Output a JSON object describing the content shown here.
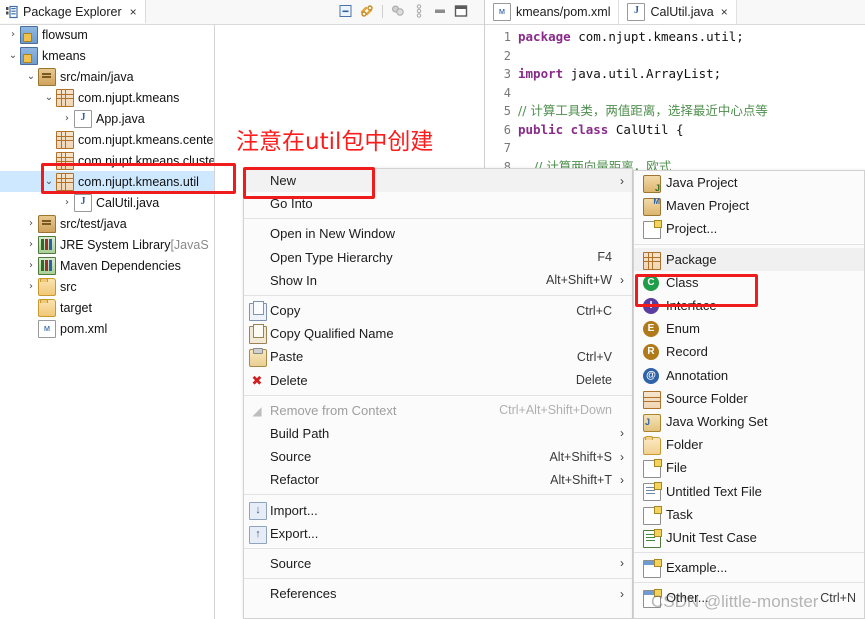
{
  "left_panel": {
    "view_tab": {
      "label": "Package Explorer",
      "close": "×",
      "icon": "package-explorer-icon"
    },
    "toolbar": [
      {
        "name": "collapse-all-icon"
      },
      {
        "name": "link-with-editor-icon"
      },
      {
        "name": "separator"
      },
      {
        "name": "view-menu-bubbles-icon"
      },
      {
        "name": "view-menu-icon"
      },
      {
        "name": "minimize-icon"
      },
      {
        "name": "maximize-icon"
      }
    ],
    "tree": [
      {
        "indent": 0,
        "twist": "›",
        "icon": "ic-proj",
        "label": "flowsum",
        "dim": "",
        "selected": false
      },
      {
        "indent": 0,
        "twist": "⌄",
        "icon": "ic-proj",
        "label": "kmeans",
        "dim": "",
        "selected": false
      },
      {
        "indent": 1,
        "twist": "⌄",
        "icon": "ic-srcfolder",
        "label": "src/main/java",
        "dim": "",
        "selected": false
      },
      {
        "indent": 2,
        "twist": "⌄",
        "icon": "ic-pkg",
        "label": "com.njupt.kmeans",
        "dim": "",
        "selected": false
      },
      {
        "indent": 3,
        "twist": "›",
        "icon": "ic-java",
        "label": "App.java",
        "dim": "",
        "selected": false
      },
      {
        "indent": 2,
        "twist": "",
        "icon": "ic-pkg",
        "label": "com.njupt.kmeans.center",
        "dim": "",
        "selected": false
      },
      {
        "indent": 2,
        "twist": "",
        "icon": "ic-pkg",
        "label": "com.njupt.kmeans.cluster",
        "dim": "",
        "selected": false
      },
      {
        "indent": 2,
        "twist": "⌄",
        "icon": "ic-pkg",
        "label": "com.njupt.kmeans.util",
        "dim": "",
        "selected": true
      },
      {
        "indent": 3,
        "twist": "›",
        "icon": "ic-java",
        "label": "CalUtil.java",
        "dim": "",
        "selected": false
      },
      {
        "indent": 1,
        "twist": "›",
        "icon": "ic-srcfolder",
        "label": "src/test/java",
        "dim": "",
        "selected": false
      },
      {
        "indent": 1,
        "twist": "›",
        "icon": "ic-lib",
        "label": "JRE System Library ",
        "dim": "[JavaS",
        "selected": false
      },
      {
        "indent": 1,
        "twist": "›",
        "icon": "ic-lib",
        "label": "Maven Dependencies",
        "dim": "",
        "selected": false
      },
      {
        "indent": 1,
        "twist": "›",
        "icon": "ic-folder",
        "label": "src",
        "dim": "",
        "selected": false
      },
      {
        "indent": 1,
        "twist": "",
        "icon": "ic-folder",
        "label": "target",
        "dim": "",
        "selected": false
      },
      {
        "indent": 1,
        "twist": "",
        "icon": "ic-xml",
        "label": "pom.xml",
        "dim": "",
        "selected": false
      }
    ]
  },
  "annotation": {
    "red_note": "注意在util包中创建",
    "highlight_color": "#f01c1c"
  },
  "editor": {
    "tabs": [
      {
        "label": "kmeans/pom.xml",
        "icon": "xml-file-icon",
        "active": false,
        "closable": false,
        "close": ""
      },
      {
        "label": "CalUtil.java",
        "icon": "java-file-icon",
        "active": true,
        "closable": true,
        "close": "×"
      }
    ],
    "code_lines": [
      {
        "num": "1",
        "segments": [
          {
            "text": "package ",
            "cls": "kw"
          },
          {
            "text": "com.njupt.kmeans.util;",
            "cls": ""
          }
        ]
      },
      {
        "num": "2",
        "segments": [
          {
            "text": "",
            "cls": ""
          }
        ]
      },
      {
        "num": "3",
        "segments": [
          {
            "text": "import ",
            "cls": "kw"
          },
          {
            "text": "java.util.ArrayList;",
            "cls": ""
          }
        ]
      },
      {
        "num": "4",
        "segments": [
          {
            "text": "",
            "cls": ""
          }
        ]
      },
      {
        "num": "5",
        "segments": [
          {
            "text": "// 计算工具类，两值距离，选择最近中心点等",
            "cls": "cmt cmt-cn"
          }
        ]
      },
      {
        "num": "6",
        "segments": [
          {
            "text": "public class ",
            "cls": "kw"
          },
          {
            "text": "CalUtil {",
            "cls": ""
          }
        ]
      },
      {
        "num": "7",
        "segments": [
          {
            "text": "",
            "cls": ""
          }
        ]
      },
      {
        "num": "8",
        "segments": [
          {
            "text": "    // 计算两向量距离，欧式",
            "cls": "cmt cmt-cn"
          }
        ]
      }
    ]
  },
  "context_menu": {
    "items": [
      {
        "type": "item",
        "label": "New",
        "accel": "",
        "arrow": true,
        "icon": "",
        "disabled": false,
        "highlighted": true
      },
      {
        "type": "item",
        "label": "Go Into",
        "accel": "",
        "arrow": false,
        "icon": "",
        "disabled": false,
        "highlighted": false
      },
      {
        "type": "sep"
      },
      {
        "type": "item",
        "label": "Open in New Window",
        "accel": "",
        "arrow": false,
        "icon": "",
        "disabled": false,
        "highlighted": false
      },
      {
        "type": "item",
        "label": "Open Type Hierarchy",
        "accel": "F4",
        "arrow": false,
        "icon": "",
        "disabled": false,
        "highlighted": false
      },
      {
        "type": "item",
        "label": "Show In",
        "accel": "Alt+Shift+W",
        "arrow": true,
        "icon": "",
        "disabled": false,
        "highlighted": false
      },
      {
        "type": "sep"
      },
      {
        "type": "item",
        "label": "Copy",
        "accel": "Ctrl+C",
        "arrow": false,
        "icon": "mic-copy",
        "disabled": false,
        "highlighted": false
      },
      {
        "type": "item",
        "label": "Copy Qualified Name",
        "accel": "",
        "arrow": false,
        "icon": "mic-copyq",
        "disabled": false,
        "highlighted": false
      },
      {
        "type": "item",
        "label": "Paste",
        "accel": "Ctrl+V",
        "arrow": false,
        "icon": "mic-paste",
        "disabled": false,
        "highlighted": false
      },
      {
        "type": "item",
        "label": "Delete",
        "accel": "Delete",
        "arrow": false,
        "icon": "mic-del",
        "disabled": false,
        "highlighted": false
      },
      {
        "type": "sep"
      },
      {
        "type": "item",
        "label": "Remove from Context",
        "accel": "Ctrl+Alt+Shift+Down",
        "arrow": false,
        "icon": "mic-rem",
        "disabled": true,
        "highlighted": false
      },
      {
        "type": "item",
        "label": "Build Path",
        "accel": "",
        "arrow": true,
        "icon": "",
        "disabled": false,
        "highlighted": false
      },
      {
        "type": "item",
        "label": "Source",
        "accel": "Alt+Shift+S",
        "arrow": true,
        "icon": "",
        "disabled": false,
        "highlighted": false
      },
      {
        "type": "item",
        "label": "Refactor",
        "accel": "Alt+Shift+T",
        "arrow": true,
        "icon": "",
        "disabled": false,
        "highlighted": false
      },
      {
        "type": "sep"
      },
      {
        "type": "item",
        "label": "Import...",
        "accel": "",
        "arrow": false,
        "icon": "mic-import",
        "disabled": false,
        "highlighted": false
      },
      {
        "type": "item",
        "label": "Export...",
        "accel": "",
        "arrow": false,
        "icon": "mic-export",
        "disabled": false,
        "highlighted": false
      },
      {
        "type": "sep"
      },
      {
        "type": "item",
        "label": "Source",
        "accel": "",
        "arrow": true,
        "icon": "",
        "disabled": false,
        "highlighted": false
      },
      {
        "type": "sep"
      },
      {
        "type": "item",
        "label": "References",
        "accel": "",
        "arrow": true,
        "icon": "",
        "disabled": false,
        "highlighted": false
      }
    ]
  },
  "submenu": {
    "items": [
      {
        "type": "item",
        "label": "Java Project",
        "accel": "",
        "icon": "sic-javaproj",
        "highlighted": false
      },
      {
        "type": "item",
        "label": "Maven Project",
        "accel": "",
        "icon": "sic-mvnproj",
        "highlighted": false
      },
      {
        "type": "item",
        "label": "Project...",
        "accel": "",
        "icon": "sic-project",
        "highlighted": false
      },
      {
        "type": "sep"
      },
      {
        "type": "item",
        "label": "Package",
        "accel": "",
        "icon": "sic-package",
        "highlighted": true
      },
      {
        "type": "item",
        "label": "Class",
        "accel": "",
        "icon": "sic-class",
        "highlighted": false
      },
      {
        "type": "item",
        "label": "Interface",
        "accel": "",
        "icon": "sic-interface",
        "highlighted": false
      },
      {
        "type": "item",
        "label": "Enum",
        "accel": "",
        "icon": "sic-enum",
        "highlighted": false
      },
      {
        "type": "item",
        "label": "Record",
        "accel": "",
        "icon": "sic-record",
        "highlighted": false
      },
      {
        "type": "item",
        "label": "Annotation",
        "accel": "",
        "icon": "sic-annotation",
        "highlighted": false
      },
      {
        "type": "item",
        "label": "Source Folder",
        "accel": "",
        "icon": "sic-srcfolder",
        "highlighted": false
      },
      {
        "type": "item",
        "label": "Java Working Set",
        "accel": "",
        "icon": "sic-workingset",
        "highlighted": false
      },
      {
        "type": "item",
        "label": "Folder",
        "accel": "",
        "icon": "sic-folder",
        "highlighted": false
      },
      {
        "type": "item",
        "label": "File",
        "accel": "",
        "icon": "sic-file",
        "highlighted": false
      },
      {
        "type": "item",
        "label": "Untitled Text File",
        "accel": "",
        "icon": "sic-textfile",
        "highlighted": false
      },
      {
        "type": "item",
        "label": "Task",
        "accel": "",
        "icon": "sic-task",
        "highlighted": false
      },
      {
        "type": "item",
        "label": "JUnit Test Case",
        "accel": "",
        "icon": "sic-junit",
        "highlighted": false
      },
      {
        "type": "sep"
      },
      {
        "type": "item",
        "label": "Example...",
        "accel": "",
        "icon": "sic-example",
        "highlighted": false
      },
      {
        "type": "sep"
      },
      {
        "type": "item",
        "label": "Other...",
        "accel": "Ctrl+N",
        "icon": "sic-other",
        "highlighted": false
      }
    ]
  },
  "watermark": {
    "text": "CSDN @little-monster"
  }
}
